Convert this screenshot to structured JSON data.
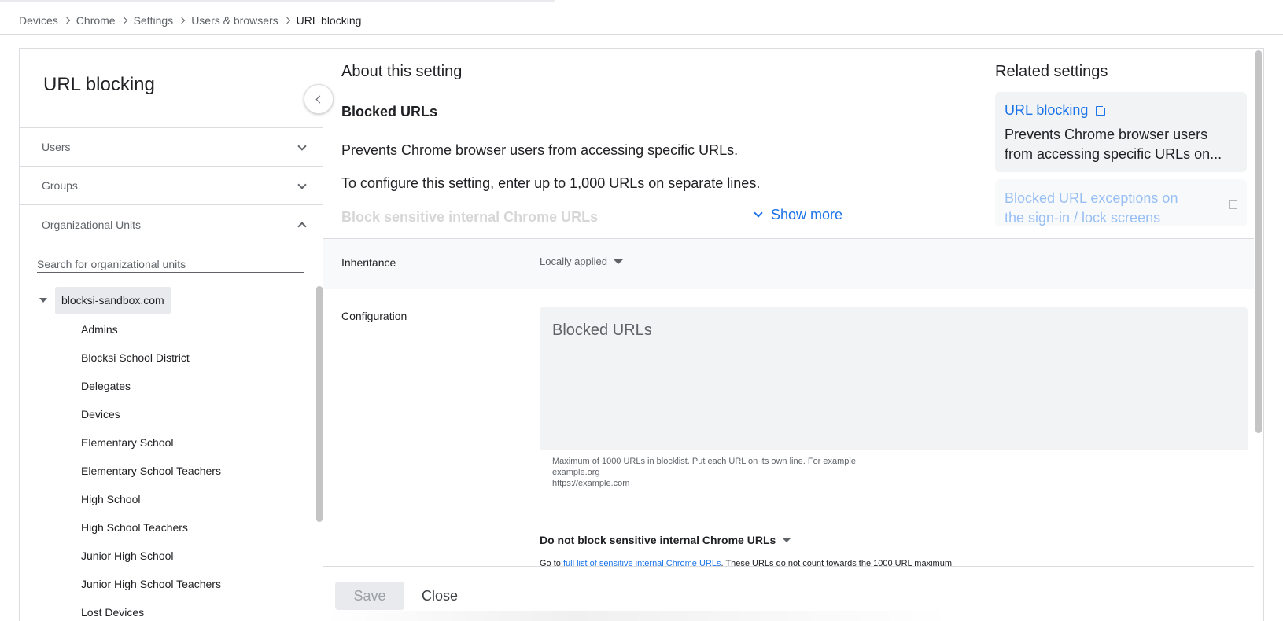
{
  "breadcrumb": [
    "Devices",
    "Chrome",
    "Settings",
    "Users & browsers",
    "URL blocking"
  ],
  "left": {
    "title": "URL blocking",
    "sections": [
      "Users",
      "Groups",
      "Organizational Units"
    ],
    "search_placeholder": "Search for organizational units",
    "root": "blocksi-sandbox.com",
    "children": [
      "Admins",
      "Blocksi School District",
      "Delegates",
      "Devices",
      "Elementary School",
      "Elementary School Teachers",
      "High School",
      "High School Teachers",
      "Junior High School",
      "Junior High School Teachers",
      "Lost Devices"
    ]
  },
  "about": {
    "title": "About this setting",
    "subtitle": "Blocked URLs",
    "p1": "Prevents Chrome browser users from accessing specific URLs.",
    "p2": "To configure this setting, enter up to 1,000 URLs on separate lines.",
    "faded": "Block sensitive internal Chrome URLs",
    "show_more": "Show more"
  },
  "related": {
    "title": "Related settings",
    "card1_link": "URL blocking",
    "card1_desc": "Prevents Chrome browser users from accessing specific URLs on...",
    "card2_link": "Blocked URL exceptions on the sign-in / lock screens"
  },
  "inheritance": {
    "label": "Inheritance",
    "value": "Locally applied"
  },
  "configuration": {
    "label": "Configuration",
    "placeholder": "Blocked URLs",
    "helper": [
      "Maximum of 1000 URLs in blocklist. Put each URL on its own line. For example",
      "example.org",
      "https://example.com"
    ],
    "sensitive_value": "Do not block sensitive internal Chrome URLs",
    "goto_prefix": "Go to ",
    "goto_link": "full list of sensitive internal Chrome URLs",
    "goto_suffix": ". These URLs do not count towards the 1000 URL maximum."
  },
  "footer": {
    "save": "Save",
    "close": "Close"
  }
}
